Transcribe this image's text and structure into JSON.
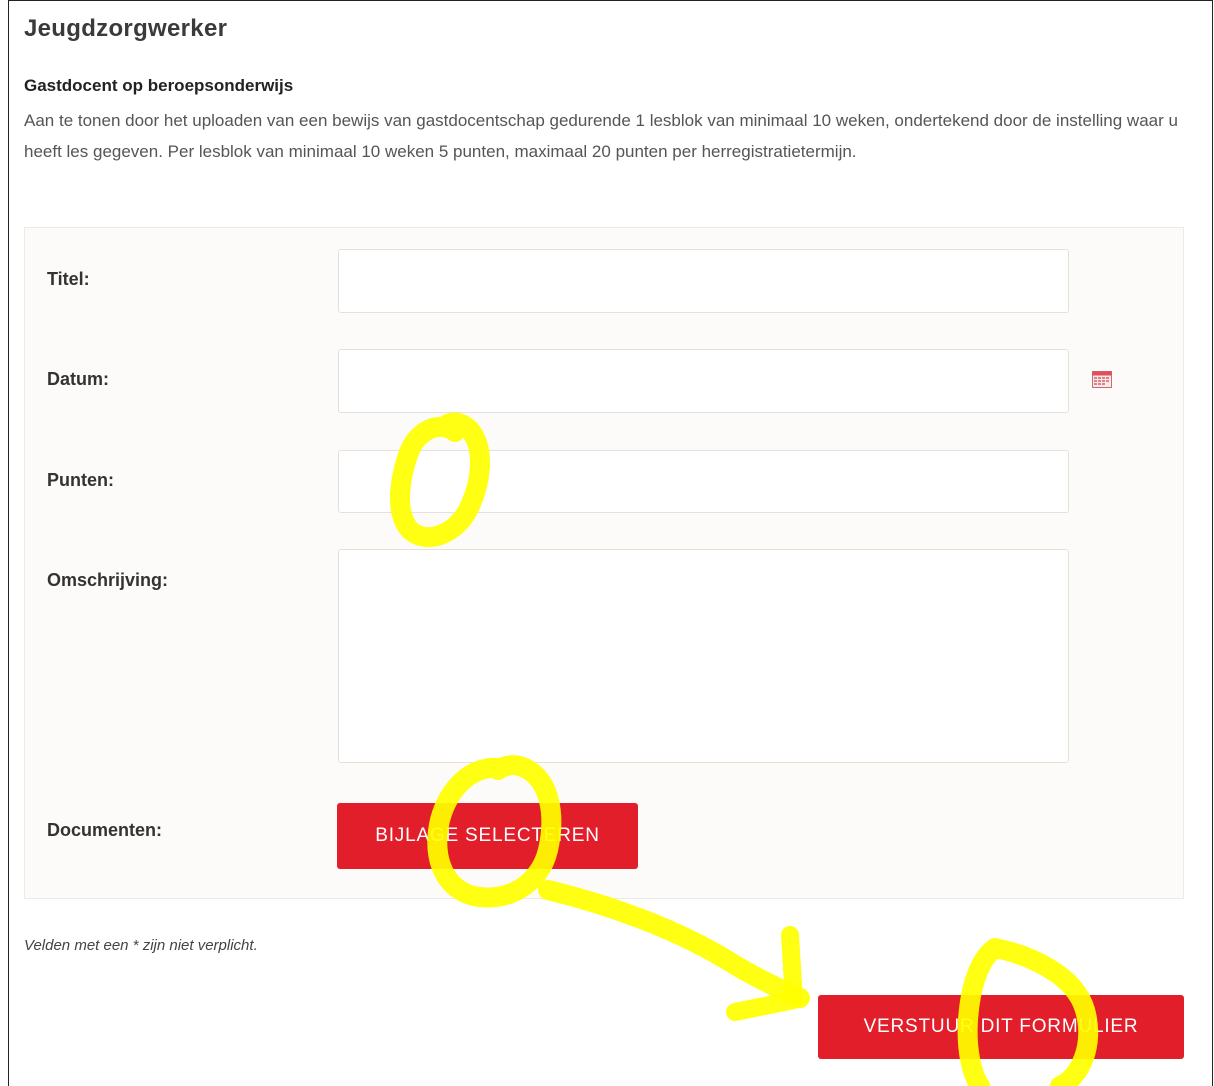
{
  "page": {
    "title": "Jeugdzorgwerker"
  },
  "section": {
    "title": "Gastdocent op beroepsonderwijs",
    "description": "Aan te tonen door het uploaden van een bewijs van gastdocentschap gedurende 1 lesblok van minimaal 10 weken, ondertekend door de instelling waar u heeft les gegeven. Per lesblok van minimaal 10 weken 5 punten, maximaal 20 punten per herregistratietermijn."
  },
  "form": {
    "titel_label": "Titel:",
    "titel_value": "",
    "datum_label": "Datum:",
    "datum_value": "",
    "punten_label": "Punten:",
    "punten_value": "",
    "omschrijving_label": "Omschrijving:",
    "omschrijving_value": "",
    "documenten_label": "Documenten:",
    "attach_button": "BIJLAGE SELECTEREN"
  },
  "footnote": "Velden met een * zijn niet verplicht.",
  "submit_button": "VERSTUUR DIT FORMULIER",
  "icons": {
    "date_picker": "calendar-icon"
  },
  "colors": {
    "accent": "#e31e2b",
    "annotation": "#ffff00",
    "form_background": "#fcfbfa"
  }
}
